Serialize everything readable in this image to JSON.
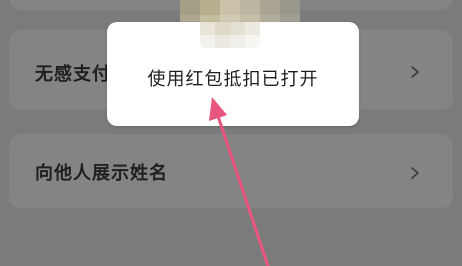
{
  "settings": {
    "items": [
      {
        "label": "无感支付",
        "chevron": "chevron-right-icon"
      },
      {
        "label": "向他人展示姓名",
        "chevron": "chevron-right-icon"
      }
    ]
  },
  "toast": {
    "message": "使用红包抵扣已打开"
  },
  "annotation": {
    "arrow_color": "#e8557f"
  },
  "colors": {
    "overlay_background": "#7b7b7b",
    "card_background": "#848484",
    "toast_background": "#ffffff"
  }
}
